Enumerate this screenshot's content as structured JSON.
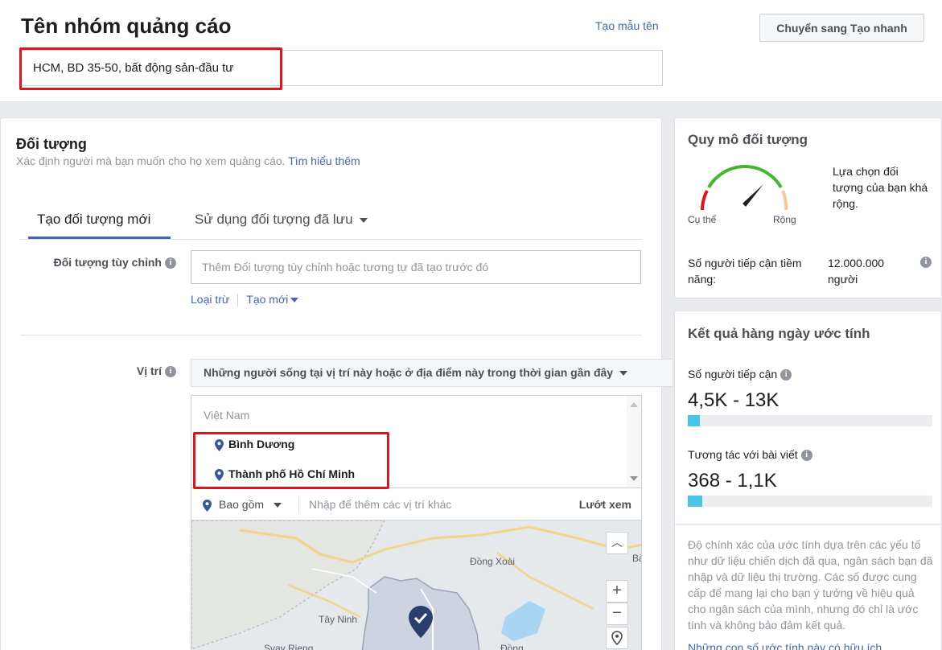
{
  "top": {
    "title": "Tên nhóm quảng cáo",
    "name_template_link": "Tạo mẫu tên",
    "quick_button": "Chuyển sang Tạo nhanh",
    "ad_set_name": "HCM, BD 35-50, bất động sản-đầu tư"
  },
  "audience": {
    "title": "Đối tượng",
    "description": "Xác định người mà bạn muốn cho họ xem quảng cáo.",
    "learn_more": "Tìm hiểu thêm",
    "tabs": [
      {
        "label": "Tạo đối tượng mới",
        "active": true
      },
      {
        "label": "Sử dụng đối tượng đã lưu",
        "active": false
      }
    ],
    "custom_audience": {
      "label": "Đối tượng tùy chỉnh",
      "placeholder": "Thêm Đối tượng tùy chỉnh hoặc tương tự đã tạo trước đó",
      "exclude_link": "Loại trừ",
      "create_link": "Tạo mới"
    },
    "location": {
      "label": "Vị trí",
      "type_selected": "Những người sống tại vị trí này hoặc ở địa điểm này trong thời gian gần đây",
      "country": "Việt Nam",
      "items": [
        "Bình Dương",
        "Thành phố Hồ Chí Minh"
      ],
      "include_label": "Bao gồm",
      "add_placeholder": "Nhập để thêm các vị trí khác",
      "browse": "Lướt xem",
      "map_labels": [
        "Đồng Xoài",
        "Tây Ninh",
        "Svay Rieng",
        "Đồng",
        "Bà"
      ]
    }
  },
  "audience_size": {
    "title": "Quy mô đối tượng",
    "left_label": "Cụ thể",
    "right_label": "Rộng",
    "description": "Lựa chọn đối tượng của bạn khá rộng.",
    "potential_reach_label": "Số người tiếp cận tiềm năng:",
    "potential_reach_value": "12.000.000 người"
  },
  "daily_results": {
    "title": "Kết quả hàng ngày ước tính",
    "reach_label": "Số người tiếp cận",
    "reach_value": "4,5K - 13K",
    "reach_fill": 0.05,
    "engagement_label": "Tương tác với bài viết",
    "engagement_value": "368 - 1,1K",
    "engagement_fill": 0.06,
    "accuracy_note": "Độ chính xác của ước tính dựa trên các yếu tố như dữ liệu chiến dịch đã qua, ngân sách bạn đã nhập và dữ liệu thị trường. Các số được cung cấp để mang lại cho bạn ý tưởng về hiệu quả cho ngân sách của mình, nhưng đó chỉ là ước tính và không bảo đảm kết quả.",
    "helpful_note": "Những con số ước tính này có hữu ích"
  },
  "colors": {
    "link": "#4267b2",
    "highlight": "#e0141e",
    "bar_fill": "#4cc3e9",
    "gauge_green": "#42b72a",
    "gauge_red": "#e0141e"
  }
}
